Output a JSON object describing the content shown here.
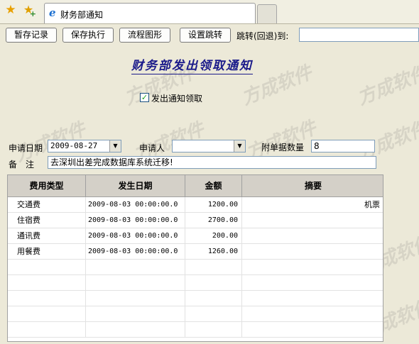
{
  "browser": {
    "tab_title": "财务部通知"
  },
  "toolbar": {
    "temp_save_label": "暂存记录",
    "save_execute_label": "保存执行",
    "flowchart_label": "流程图形",
    "set_jump_label": "设置跳转",
    "jump_label": "跳转(回退)到:"
  },
  "document": {
    "title": "财务部发出领取通知",
    "watermark": "方成软件"
  },
  "form": {
    "issue_notice_label": "发出通知领取",
    "issue_notice_checked": true,
    "apply_date_label": "申请日期",
    "apply_date_value": "2009-08-27",
    "applicant_label": "申请人",
    "applicant_value": "",
    "attachment_count_label": "附单据数量",
    "attachment_count_value": "8",
    "remark_label": "备　注",
    "remark_value": "去深圳出差完成数据库系统迁移!"
  },
  "grid": {
    "columns": [
      "费用类型",
      "发生日期",
      "金额",
      "摘要"
    ],
    "rows": [
      {
        "type": "交通费",
        "date": "2009-08-03 00:00:00.0",
        "amount": "1200.00",
        "summary": "机票"
      },
      {
        "type": "住宿费",
        "date": "2009-08-03 00:00:00.0",
        "amount": "2700.00",
        "summary": ""
      },
      {
        "type": "通讯费",
        "date": "2009-08-03 00:00:00.0",
        "amount": "200.00",
        "summary": ""
      },
      {
        "type": "用餐费",
        "date": "2009-08-03 00:00:00.0",
        "amount": "1260.00",
        "summary": ""
      }
    ]
  },
  "icons": {
    "favorites": "star-icon",
    "add_favorite": "add-favorite-icon",
    "browser": "ie-icon",
    "dropdown": "chevron-down-icon",
    "check": "checkmark-icon"
  }
}
